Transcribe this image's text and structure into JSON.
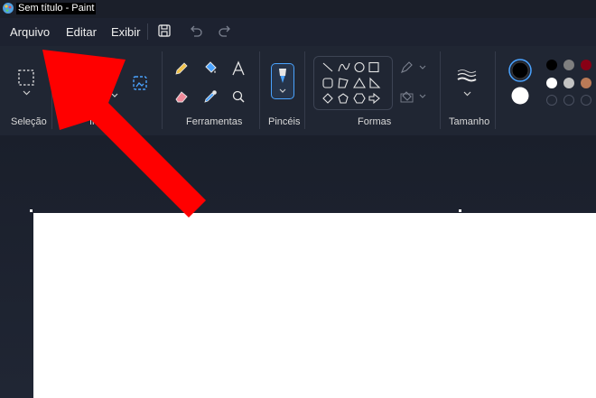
{
  "window": {
    "title": "Sem título - Paint"
  },
  "menu": {
    "file": "Arquivo",
    "edit": "Editar",
    "view": "Exibir"
  },
  "ribbon": {
    "groups": {
      "selection": "Seleção",
      "image": "Imagem",
      "tools": "Ferramentas",
      "brushes": "Pincéis",
      "shapes": "Formas",
      "size": "Tamanho"
    }
  },
  "colors": {
    "primary": "#000000",
    "secondary": "#ffffff",
    "palette": [
      "#000000",
      "#7f7f7f",
      "#880015",
      "#ffffff",
      "#c3c3c3",
      "#b97a57"
    ],
    "annotation_arrow": "#ff0000"
  }
}
